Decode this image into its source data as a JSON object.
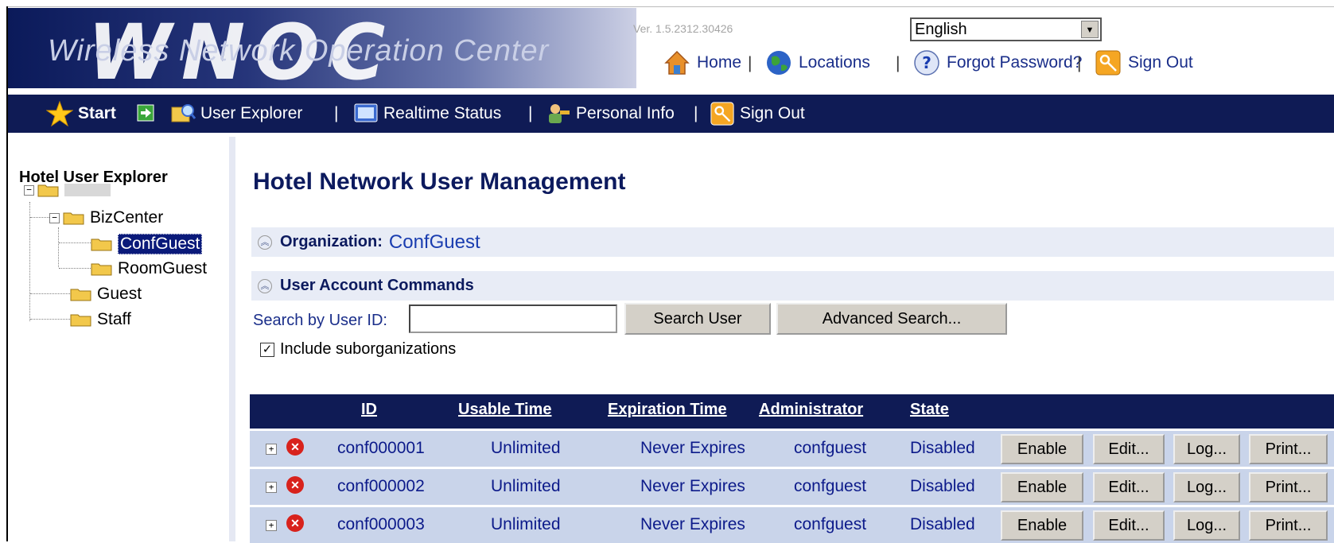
{
  "header": {
    "app_title": "Wireless Network Operation Center",
    "logo_text": "WNOC",
    "version": "Ver. 1.5.2312.30426",
    "language": {
      "selected": "English"
    },
    "links": [
      {
        "label": "Home",
        "icon": "home-icon"
      },
      {
        "label": "Locations",
        "icon": "globe-icon"
      },
      {
        "label": "Forgot Password?",
        "icon": "help-icon"
      },
      {
        "label": "Sign Out",
        "icon": "key-icon"
      }
    ],
    "separator": "|"
  },
  "nav": {
    "start": "Start",
    "items": [
      {
        "label": "User Explorer",
        "icon": "user-explorer-icon"
      },
      {
        "label": "Realtime Status",
        "icon": "monitor-icon"
      },
      {
        "label": "Personal Info",
        "icon": "personal-info-icon"
      },
      {
        "label": "Sign Out",
        "icon": "key-icon"
      }
    ],
    "separator": "|"
  },
  "sidebar": {
    "title": "Hotel User Explorer",
    "tree": {
      "root": "",
      "children": [
        {
          "label": "BizCenter",
          "children": [
            "ConfGuest",
            "RoomGuest"
          ]
        },
        {
          "label": "Guest"
        },
        {
          "label": "Staff"
        }
      ],
      "selected": "ConfGuest"
    }
  },
  "main": {
    "title": "Hotel Network User Management",
    "organization_label": "Organization:",
    "organization_value": "ConfGuest",
    "commands_label": "User Account Commands",
    "search_label": "Search by User ID:",
    "search_value": "",
    "search_button": "Search User",
    "advanced_button": "Advanced Search...",
    "include_sub_label": "Include suborganizations",
    "include_sub_checked": true
  },
  "table": {
    "columns": [
      "ID",
      "Usable Time",
      "Expiration Time",
      "Administrator",
      "State"
    ],
    "rows": [
      {
        "id": "conf000001",
        "usable": "Unlimited",
        "expiration": "Never Expires",
        "admin": "confguest",
        "state": "Disabled"
      },
      {
        "id": "conf000002",
        "usable": "Unlimited",
        "expiration": "Never Expires",
        "admin": "confguest",
        "state": "Disabled"
      },
      {
        "id": "conf000003",
        "usable": "Unlimited",
        "expiration": "Never Expires",
        "admin": "confguest",
        "state": "Disabled"
      }
    ],
    "row_actions": [
      "Enable",
      "Edit...",
      "Log...",
      "Print..."
    ]
  },
  "colors": {
    "nav_bg": "#0f1b55",
    "row_bg": "#c9d4ea",
    "section_bg": "#e8ecf6",
    "link": "#1a2e8a",
    "error": "#d8221c"
  }
}
